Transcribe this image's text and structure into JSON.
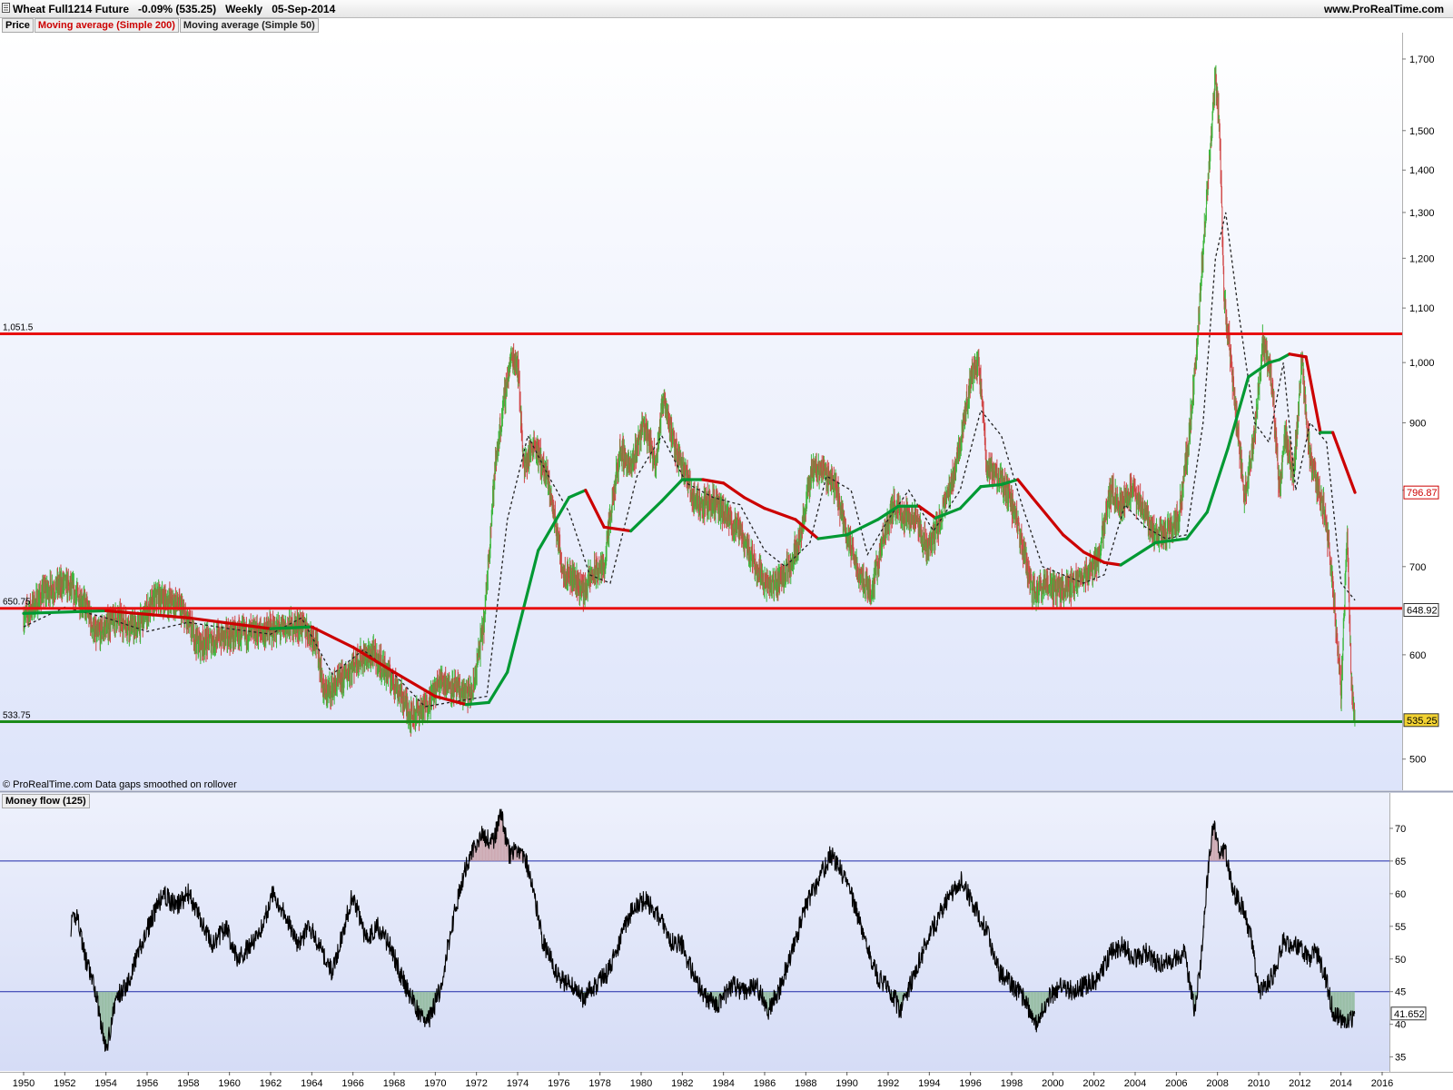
{
  "header": {
    "title": "Wheat Full1214 Future   -0.09% (535.25)   Weekly   05-Sep-2014",
    "brand": "www.ProRealTime.com"
  },
  "legend": {
    "price": "Price",
    "ma200": "Moving average (Simple 200)",
    "ma50": "Moving average (Simple 50)"
  },
  "footer_note": "© ProRealTime.com  Data gaps smoothed on rollover",
  "money_flow_label": "Money flow (125)",
  "colors": {
    "price_up": "#3cb63c",
    "price_down": "#d04545",
    "ma200": "#cc0000",
    "ma50": "#009933",
    "resistance": "#e81010",
    "support": "#1a8a1a",
    "mf_line": "#000000",
    "mf_ref": "#1f2aa8",
    "mf_over": "#c9a0a8",
    "mf_under": "#8fb99a"
  },
  "chart_data": [
    {
      "type": "line",
      "name": "price",
      "x": [
        1950.0,
        1951.0,
        1952.0,
        1953.0,
        1953.5,
        1954.5,
        1955.5,
        1956.5,
        1957.5,
        1958.5,
        1959.5,
        1960.5,
        1961.5,
        1962.5,
        1963.5,
        1964.2,
        1964.6,
        1965.5,
        1966.2,
        1967.0,
        1968.0,
        1968.8,
        1969.5,
        1970.3,
        1971.2,
        1971.8,
        1972.4,
        1972.9,
        1973.4,
        1973.7,
        1974.0,
        1974.3,
        1974.8,
        1975.5,
        1976.2,
        1976.8,
        1977.2,
        1977.6,
        1978.2,
        1979.0,
        1979.5,
        1980.1,
        1980.7,
        1981.1,
        1981.6,
        1982.0,
        1982.5,
        1983.0,
        1983.5,
        1984.2,
        1984.8,
        1985.6,
        1986.2,
        1986.6,
        1987.2,
        1987.8,
        1988.3,
        1988.8,
        1989.4,
        1990.0,
        1990.6,
        1991.2,
        1991.8,
        1992.3,
        1992.8,
        1993.3,
        1993.9,
        1994.4,
        1995.0,
        1995.5,
        1996.0,
        1996.4,
        1996.8,
        1997.3,
        1997.9,
        1998.5,
        1999.0,
        1999.6,
        2000.3,
        2001.0,
        2001.6,
        2002.2,
        2002.8,
        2003.3,
        2003.8,
        2004.3,
        2004.9,
        2005.5,
        2006.1,
        2006.6,
        2007.0,
        2007.5,
        2007.9,
        2008.1,
        2008.3,
        2008.6,
        2008.9,
        2009.3,
        2009.8,
        2010.2,
        2010.6,
        2011.0,
        2011.3,
        2011.7,
        2012.1,
        2012.5,
        2012.8,
        2013.2,
        2013.6,
        2014.0,
        2014.3,
        2014.5,
        2014.68
      ],
      "values": [
        640,
        670,
        680,
        655,
        620,
        640,
        628,
        665,
        655,
        612,
        618,
        622,
        624,
        628,
        632,
        616,
        560,
        575,
        595,
        600,
        572,
        540,
        547,
        575,
        562,
        560,
        640,
        830,
        950,
        1010,
        1000,
        830,
        870,
        810,
        695,
        685,
        670,
        690,
        700,
        860,
        830,
        900,
        840,
        945,
        860,
        840,
        790,
        780,
        785,
        760,
        745,
        700,
        675,
        680,
        700,
        745,
        830,
        830,
        810,
        740,
        690,
        670,
        740,
        780,
        765,
        760,
        720,
        750,
        800,
        870,
        970,
        1000,
        830,
        820,
        790,
        730,
        670,
        680,
        670,
        680,
        690,
        710,
        800,
        780,
        800,
        780,
        740,
        740,
        760,
        870,
        1020,
        1350,
        1650,
        1500,
        1130,
        1020,
        910,
        790,
        880,
        1040,
        980,
        800,
        880,
        820,
        1000,
        840,
        810,
        770,
        680,
        560,
        740,
        570,
        535.25
      ]
    },
    {
      "type": "line",
      "name": "Moving average (Simple 200)",
      "x": [
        1950.0,
        1954.0,
        1958.0,
        1962.0,
        1964.0,
        1966.0,
        1968.0,
        1970.0,
        1971.5,
        1972.6,
        1973.5,
        1975.0,
        1976.5,
        1977.3,
        1978.2,
        1979.5,
        1981.0,
        1982.0,
        1983.0,
        1984.0,
        1985.0,
        1986.0,
        1987.5,
        1988.6,
        1990.0,
        1991.5,
        1992.5,
        1993.5,
        1994.3,
        1995.5,
        1996.5,
        1997.5,
        1998.3,
        1999.0,
        2000.5,
        2001.5,
        2002.5,
        2003.3,
        2005.0,
        2006.5,
        2007.5,
        2008.5,
        2009.5,
        2010.5,
        2011.0,
        2011.5,
        2012.3,
        2013.0,
        2013.6,
        2014.68
      ],
      "values": [
        645,
        648,
        640,
        628,
        630,
        608,
        582,
        558,
        550,
        552,
        582,
        720,
        790,
        800,
        750,
        745,
        785,
        815,
        815,
        810,
        790,
        775,
        760,
        735,
        740,
        760,
        778,
        778,
        762,
        775,
        805,
        808,
        815,
        790,
        740,
        718,
        705,
        702,
        730,
        735,
        770,
        860,
        975,
        1000,
        1005,
        1015,
        1010,
        885,
        885,
        796.87
      ]
    },
    {
      "type": "line",
      "name": "Moving average (Simple 50)",
      "x": [
        1950.0,
        1952.0,
        1954.0,
        1956.0,
        1958.0,
        1960.0,
        1962.0,
        1963.5,
        1965.0,
        1966.5,
        1968.0,
        1969.5,
        1971.0,
        1972.5,
        1973.5,
        1974.5,
        1975.5,
        1976.5,
        1977.5,
        1978.5,
        1979.8,
        1981.0,
        1982.2,
        1983.5,
        1984.8,
        1986.0,
        1987.0,
        1988.2,
        1989.0,
        1990.2,
        1991.0,
        1992.0,
        1993.0,
        1994.2,
        1995.5,
        1996.5,
        1997.5,
        1998.5,
        1999.5,
        2000.5,
        2001.5,
        2002.5,
        2003.5,
        2004.5,
        2005.5,
        2006.5,
        2007.3,
        2007.9,
        2008.4,
        2009.0,
        2009.8,
        2010.5,
        2011.2,
        2011.8,
        2012.5,
        2013.3,
        2014.0,
        2014.68
      ],
      "values": [
        630,
        652,
        640,
        625,
        635,
        628,
        622,
        640,
        580,
        605,
        580,
        548,
        553,
        558,
        760,
        880,
        820,
        770,
        690,
        680,
        820,
        880,
        810,
        790,
        780,
        720,
        700,
        730,
        820,
        800,
        715,
        760,
        800,
        745,
        800,
        920,
        880,
        780,
        700,
        690,
        680,
        690,
        780,
        750,
        735,
        740,
        900,
        1200,
        1300,
        1100,
        900,
        870,
        1000,
        800,
        900,
        870,
        680,
        660
      ]
    },
    {
      "type": "line",
      "name": "Money flow (125)",
      "x": [
        1952.3,
        1952.6,
        1953.0,
        1953.5,
        1954.0,
        1954.5,
        1955.0,
        1955.6,
        1956.2,
        1956.8,
        1957.4,
        1958.0,
        1958.6,
        1959.2,
        1959.8,
        1960.4,
        1961.0,
        1961.6,
        1962.1,
        1962.7,
        1963.3,
        1963.9,
        1964.5,
        1965.0,
        1965.5,
        1966.0,
        1966.6,
        1967.2,
        1967.8,
        1968.4,
        1969.0,
        1969.6,
        1970.2,
        1970.8,
        1971.3,
        1971.8,
        1972.3,
        1972.8,
        1973.2,
        1973.6,
        1974.0,
        1974.4,
        1974.8,
        1975.2,
        1975.6,
        1976.0,
        1976.6,
        1977.2,
        1977.8,
        1978.4,
        1979.0,
        1979.6,
        1980.2,
        1980.8,
        1981.4,
        1982.0,
        1982.6,
        1983.2,
        1983.8,
        1984.4,
        1985.0,
        1985.6,
        1986.2,
        1986.8,
        1987.4,
        1988.0,
        1988.6,
        1989.2,
        1989.8,
        1990.4,
        1991.0,
        1991.5,
        1992.0,
        1992.6,
        1993.2,
        1993.8,
        1994.4,
        1995.0,
        1995.6,
        1996.2,
        1996.8,
        1997.4,
        1998.0,
        1998.6,
        1999.2,
        1999.8,
        2000.4,
        2001.0,
        2001.6,
        2002.2,
        2002.8,
        2003.4,
        2004.0,
        2004.6,
        2005.2,
        2005.8,
        2006.4,
        2006.9,
        2007.2,
        2007.5,
        2007.8,
        2008.0,
        2008.4,
        2008.8,
        2009.2,
        2009.6,
        2010.0,
        2010.4,
        2010.8,
        2011.2,
        2011.6,
        2012.0,
        2012.4,
        2012.8,
        2013.2,
        2013.6,
        2014.0,
        2014.3,
        2014.68
      ],
      "values": [
        55,
        57,
        50,
        45,
        36,
        44,
        46,
        51,
        56,
        60,
        58,
        60,
        56,
        52,
        55,
        50,
        52,
        55,
        60,
        57,
        52,
        55,
        51,
        48,
        54,
        60,
        53,
        55,
        52,
        47,
        43,
        40,
        45,
        55,
        62,
        67,
        69,
        68,
        72,
        66,
        67,
        65,
        60,
        53,
        50,
        47,
        46,
        44,
        46,
        48,
        53,
        58,
        59,
        57,
        53,
        52,
        47,
        44,
        43,
        46,
        45,
        46,
        42,
        46,
        52,
        58,
        62,
        66,
        63,
        58,
        52,
        47,
        46,
        42,
        47,
        52,
        56,
        60,
        62,
        58,
        54,
        48,
        46,
        44,
        40,
        44,
        46,
        45,
        46,
        47,
        51,
        52,
        50,
        51,
        49,
        50,
        51,
        42,
        50,
        62,
        71,
        67,
        66,
        60,
        58,
        54,
        45,
        46,
        48,
        53,
        52,
        52,
        50,
        51,
        48,
        42,
        41,
        40,
        41.652
      ]
    }
  ],
  "axes": {
    "x_ticks": [
      "1950",
      "1952",
      "1954",
      "1956",
      "1958",
      "1960",
      "1962",
      "1964",
      "1966",
      "1968",
      "1970",
      "1972",
      "1974",
      "1976",
      "1978",
      "1980",
      "1982",
      "1984",
      "1986",
      "1988",
      "1990",
      "1992",
      "1994",
      "1996",
      "1998",
      "2000",
      "2002",
      "2004",
      "2006",
      "2008",
      "2010",
      "2012",
      "2014",
      "2016"
    ],
    "x_range": [
      1949.8,
      2016.7
    ],
    "price_scale": "log",
    "price_range": [
      475,
      1780
    ],
    "price_ticks": [
      500,
      600,
      700,
      800,
      900,
      1000,
      1100,
      1200,
      1300,
      1400,
      1500,
      1700
    ],
    "price_tick_labels": [
      "500",
      "600",
      "700",
      "",
      "900",
      "1,000",
      "1,100",
      "1,200",
      "1,300",
      "1,400",
      "1,500",
      "1,700"
    ],
    "mf_range": [
      33,
      75
    ],
    "mf_ticks": [
      35,
      40,
      45,
      50,
      55,
      60,
      65,
      70
    ],
    "mf_ref_levels": [
      65,
      45
    ]
  },
  "levels": [
    {
      "label": "1,051.5",
      "value": 1051.5,
      "color": "#e81010"
    },
    {
      "label": "650.75",
      "value": 650.75,
      "color": "#e81010"
    },
    {
      "label": "533.75",
      "value": 533.75,
      "color": "#1a8a1a"
    }
  ],
  "badges": [
    {
      "label": "796.87",
      "value": 796.87,
      "pane": "price",
      "fill": "#ffffff",
      "stroke": "#cc0000",
      "text": "#cc0000"
    },
    {
      "label": "648.92",
      "value": 648.92,
      "pane": "price",
      "fill": "#ffffff",
      "stroke": "#333333",
      "text": "#000000"
    },
    {
      "label": "535.25",
      "value": 535.25,
      "pane": "price",
      "fill": "#f2d232",
      "stroke": "#333333",
      "text": "#000000"
    },
    {
      "label": "41.652",
      "value": 41.652,
      "pane": "mf",
      "fill": "#ffffff",
      "stroke": "#333333",
      "text": "#000000"
    }
  ]
}
